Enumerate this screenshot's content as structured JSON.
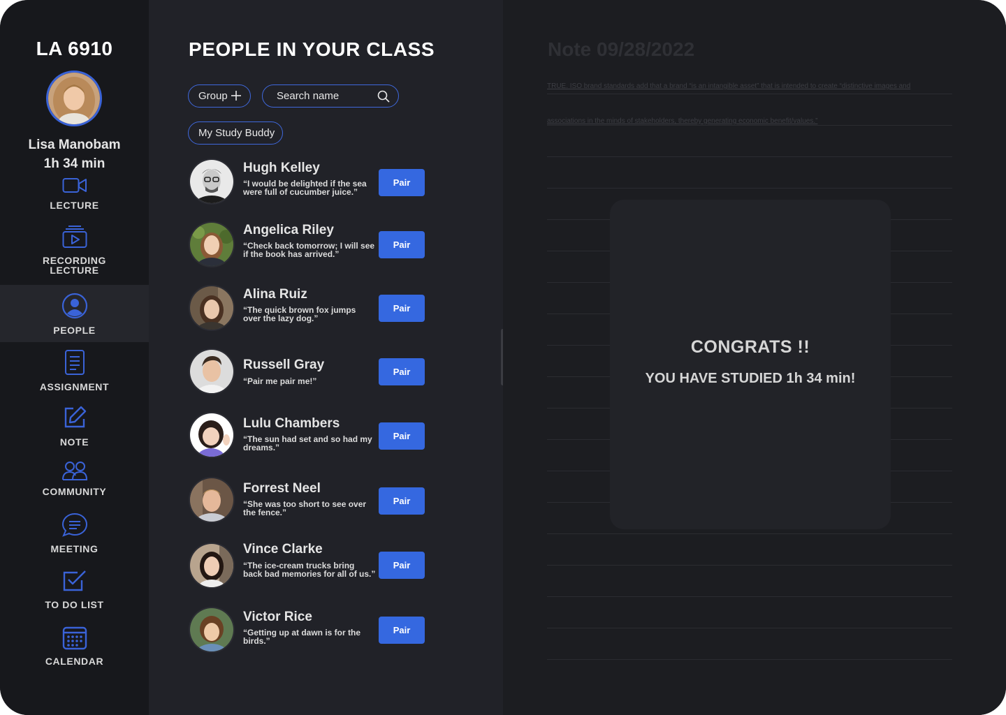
{
  "sidebar": {
    "course_code": "LA 6910",
    "user_name": "Lisa Manobam",
    "study_time": "1h 34 min",
    "accent_color": "#3a63d8",
    "nav": [
      {
        "label": "LECTURE",
        "icon": "video-camera-icon"
      },
      {
        "label": "RECORDING LECTURE",
        "icon": "recording-play-icon"
      },
      {
        "label": "PEOPLE",
        "icon": "person-icon",
        "active": true
      },
      {
        "label": "ASSIGNMENT",
        "icon": "document-icon"
      },
      {
        "label": "NOTE",
        "icon": "edit-note-icon"
      },
      {
        "label": "COMMUNITY",
        "icon": "community-icon"
      },
      {
        "label": "MEETING",
        "icon": "chat-bubble-icon"
      },
      {
        "label": "TO DO LIST",
        "icon": "checkbox-icon"
      },
      {
        "label": "CALENDAR",
        "icon": "calendar-icon"
      }
    ]
  },
  "people": {
    "title": "PEOPLE IN YOUR CLASS",
    "group_label": "Group",
    "search_placeholder": "Search name",
    "buddy_label": "My Study Buddy",
    "pair_label": "Pair",
    "button_color": "#3568e0",
    "list": [
      {
        "name": "Hugh Kelley",
        "quote": "“I would be delighted if the sea were full of cucumber juice.”"
      },
      {
        "name": "Angelica Riley",
        "quote": "“Check back tomorrow; I will see if the book has arrived.”"
      },
      {
        "name": "Alina Ruiz",
        "quote": "“The quick brown fox jumps over the lazy dog.”"
      },
      {
        "name": "Russell Gray",
        "quote": "“Pair me pair me!”"
      },
      {
        "name": "Lulu Chambers",
        "quote": "“The sun had set and so had my dreams.”"
      },
      {
        "name": "Forrest Neel",
        "quote": "“She was too short to see over the fence.”"
      },
      {
        "name": "Vince Clarke",
        "quote": "“The ice-cream trucks bring back bad memories for all of us.”"
      },
      {
        "name": "Victor Rice",
        "quote": "“Getting up at dawn is for the birds.”"
      }
    ]
  },
  "note": {
    "title": "Note 09/28/2022",
    "line1": "TRUE. ISO brand standards add that a brand “is an intangible asset” that is intended to create “distinctive images and",
    "line2": "associations in the minds of stakeholders, thereby generating economic benefit/values.”"
  },
  "congrats": {
    "title": "CONGRATS !!",
    "message": "YOU HAVE STUDIED 1h 34 min!"
  }
}
